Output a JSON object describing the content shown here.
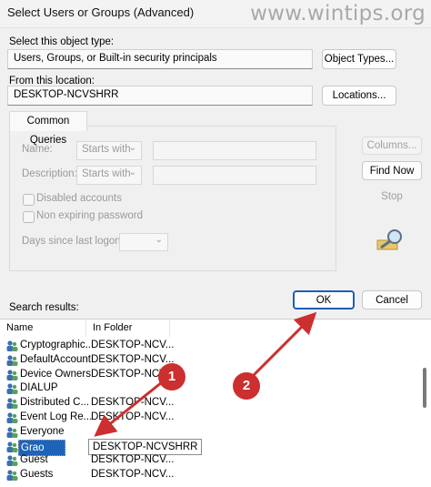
{
  "window": {
    "title": "Select Users or Groups (Advanced)"
  },
  "watermark": "www.wintips.org",
  "object_type": {
    "label": "Select this object type:",
    "value": "Users, Groups, or Built-in security principals",
    "button": "Object Types..."
  },
  "location": {
    "label": "From this location:",
    "value": "DESKTOP-NCVSHRR",
    "button": "Locations..."
  },
  "common_queries": {
    "tab": "Common Queries",
    "name_label": "Name:",
    "name_mode": "Starts with",
    "description_label": "Description:",
    "description_mode": "Starts with",
    "disabled_accounts": "Disabled accounts",
    "non_expiring_password": "Non expiring password",
    "days_since_logon": "Days since last logon:"
  },
  "side_buttons": {
    "columns": "Columns...",
    "find_now": "Find Now",
    "stop": "Stop"
  },
  "dialog_buttons": {
    "ok": "OK",
    "cancel": "Cancel"
  },
  "results": {
    "label": "Search results:",
    "columns": [
      "Name",
      "In Folder"
    ],
    "rows": [
      {
        "name": "Cryptographic...",
        "folder": "DESKTOP-NCV..."
      },
      {
        "name": "DefaultAccount",
        "folder": "DESKTOP-NCV..."
      },
      {
        "name": "Device Owners",
        "folder": "DESKTOP-NCV..."
      },
      {
        "name": "DIALUP",
        "folder": ""
      },
      {
        "name": "Distributed C...",
        "folder": "DESKTOP-NCV..."
      },
      {
        "name": "Event Log Re...",
        "folder": "DESKTOP-NCV..."
      },
      {
        "name": "Everyone",
        "folder": ""
      },
      {
        "name": "Grao",
        "folder": "DESKTOP-NCVSHRR",
        "selected": true
      },
      {
        "name": "Guest",
        "folder": "DESKTOP-NCV..."
      },
      {
        "name": "Guests",
        "folder": "DESKTOP-NCV..."
      }
    ]
  },
  "callouts": [
    "1",
    "2"
  ],
  "colors": {
    "accent": "#1e5fb3",
    "selection": "#1f63b8",
    "annotation": "#cc2f2f"
  }
}
